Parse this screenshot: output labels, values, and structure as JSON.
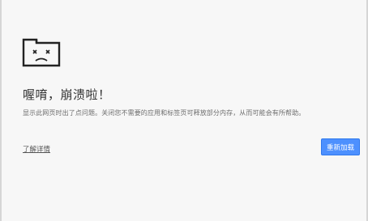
{
  "error": {
    "icon": "sad-tab-icon",
    "title": "喔唷，崩溃啦！",
    "message": "显示此网页时出了点问题。关闭您不需要的应用和标签页可释放部分内存，从而可能会有所帮助。",
    "details_link": "了解详情",
    "reload_button": "重新加载"
  },
  "colors": {
    "background": "#f7f7f7",
    "title_text": "#333333",
    "body_text": "#6e6e6e",
    "button_bg": "#4d90fe",
    "button_border": "#3079ed"
  }
}
